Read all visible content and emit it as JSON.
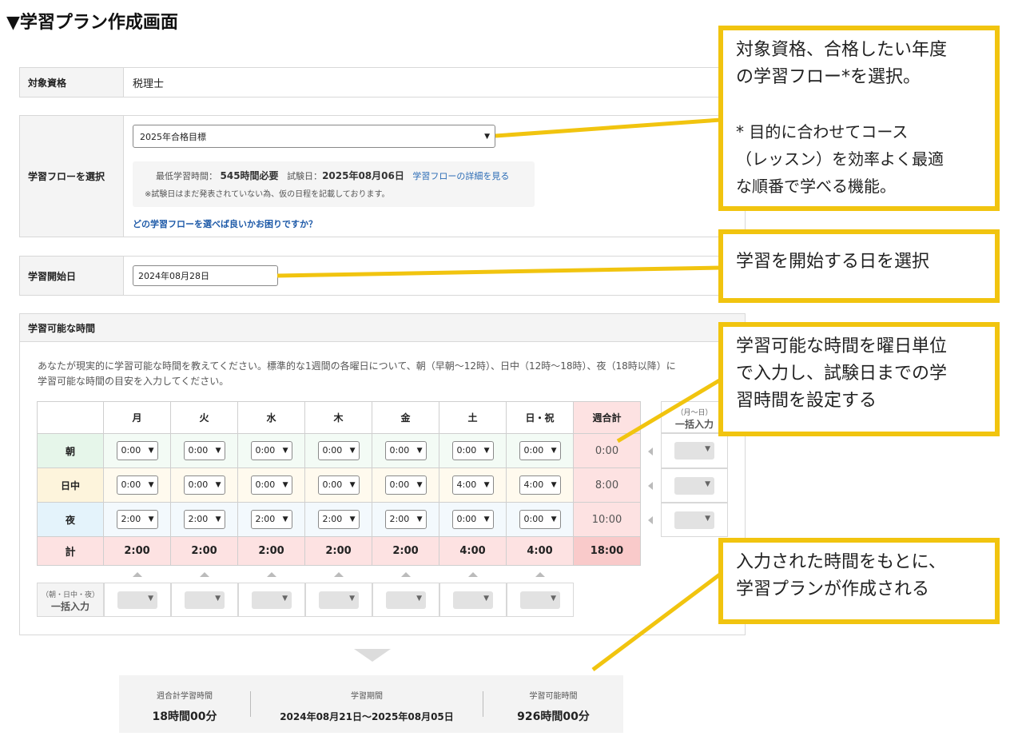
{
  "page": {
    "title": "▼学習プラン作成画面"
  },
  "qualification": {
    "label": "対象資格",
    "value": "税理士"
  },
  "flow": {
    "label": "学習フローを選択",
    "selected": "2025年合格目標",
    "min_hours_label": "最低学習時間：",
    "min_hours_value": "545時間必要",
    "exam_date_label": "試験日：",
    "exam_date_value": "2025年08月06日",
    "detail_link": "学習フローの詳細を見る",
    "note": "※試験日はまだ発表されていない為、仮の日程を記載しております。",
    "help_link": "どの学習フローを選べば良いかお困りですか？"
  },
  "start_date": {
    "label": "学習開始日",
    "value": "2024年08月28日"
  },
  "time_panel": {
    "title": "学習可能な時間",
    "description_1": "あなたが現実的に学習可能な時間を教えてください。標準的な1週間の各曜日について、朝（早朝～12時）、日中（12時～18時）、夜（18時以降）に",
    "description_2": "学習可能な時間の目安を入力してください。",
    "days": [
      "月",
      "火",
      "水",
      "木",
      "金",
      "土",
      "日・祝"
    ],
    "weekly_total_label": "週合計",
    "rows": [
      {
        "label": "朝",
        "values": [
          "0:00",
          "0:00",
          "0:00",
          "0:00",
          "0:00",
          "0:00",
          "0:00"
        ],
        "total": "0:00"
      },
      {
        "label": "日中",
        "values": [
          "0:00",
          "0:00",
          "0:00",
          "0:00",
          "0:00",
          "4:00",
          "4:00"
        ],
        "total": "8:00"
      },
      {
        "label": "夜",
        "values": [
          "2:00",
          "2:00",
          "2:00",
          "2:00",
          "2:00",
          "0:00",
          "0:00"
        ],
        "total": "10:00"
      }
    ],
    "totals": {
      "label": "計",
      "values": [
        "2:00",
        "2:00",
        "2:00",
        "2:00",
        "2:00",
        "4:00",
        "4:00"
      ],
      "grand": "18:00"
    },
    "side_bulk": {
      "sub": "（月～日）",
      "label": "一括入力"
    },
    "bottom_bulk": {
      "sub": "（朝・日中・夜）",
      "label": "一括入力"
    }
  },
  "summary": {
    "weekly_label": "週合計学習時間",
    "weekly_value": "18時間00分",
    "period_label": "学習期間",
    "period_value": "2024年08月21日～2025年08月05日",
    "available_label": "学習可能時間",
    "available_value": "926時間00分"
  },
  "callouts": {
    "c1_line1": "対象資格、合格したい年度",
    "c1_line2": "の学習フロー*を選択。",
    "c1_line3": "* 目的に合わせてコース",
    "c1_line4": "（レッスン）を効率よく最適",
    "c1_line5": "な順番で学べる機能。",
    "c2_line1": "学習を開始する日を選択",
    "c3_line1": "学習可能な時間を曜日単位",
    "c3_line2": "で入力し、試験日までの学",
    "c3_line3": "習時間を設定する",
    "c4_line1": "入力された時間をもとに、",
    "c4_line2": "学習プランが作成される"
  },
  "colors": {
    "callout_border": "#f1c40f",
    "link": "#2a6bb5",
    "total_bg": "#fde2e2"
  }
}
